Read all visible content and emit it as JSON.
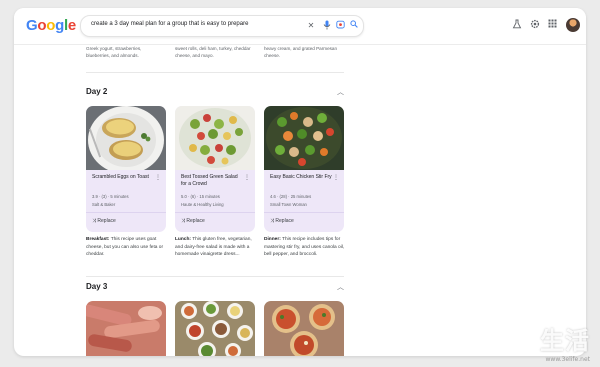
{
  "logo": {
    "text": "Google"
  },
  "search": {
    "query": "create a 3 day meal plan for a group that is easy to prepare"
  },
  "previous_day_text": [
    "Breakfast: This no-cook recipe uses Greek yogurt, strawberries, blueberries, and almonds.",
    "Lunch: This recipe uses Hawaiian sweet rolls, deli ham, turkey, cheddar cheese, and mayo.",
    "Dinner: This recipe uses linguine, heavy cream, and grated Parmesan cheese."
  ],
  "day2": {
    "label": "Day 2",
    "cards": [
      {
        "title": "Scrambled Eggs on Toast",
        "meta": "3.9 · (3) · 5 minutes",
        "source": "Salt & Baker",
        "replace": "Replace",
        "desc_label": "Breakfast:",
        "desc": " This recipe uses goat cheese, but you can also use feta or cheddar."
      },
      {
        "title": "Best Tossed Green Salad for a Crowd",
        "meta": "5.0 · (6) · 15 minutes",
        "source": "Haute & Healthy Living",
        "replace": "Replace",
        "desc_label": "Lunch:",
        "desc": " This gluten free, vegetarian, and dairy-free salad is made with a homemade vinaigrette dress..."
      },
      {
        "title": "Easy Basic Chicken Stir Fry",
        "meta": "4.6 · (28) · 25 minutes",
        "source": "Small Town Woman",
        "replace": "Replace",
        "desc_label": "Dinner:",
        "desc": " This recipe includes tips for mastering stir fry, and uses canola oil, bell pepper, and broccoli."
      }
    ]
  },
  "day3": {
    "label": "Day 3"
  },
  "watermark": {
    "main": "生活",
    "sub": "www.3elife.net"
  },
  "colors": {
    "card_bg": "#eee7f8",
    "page_bg": "#ebebeb"
  }
}
